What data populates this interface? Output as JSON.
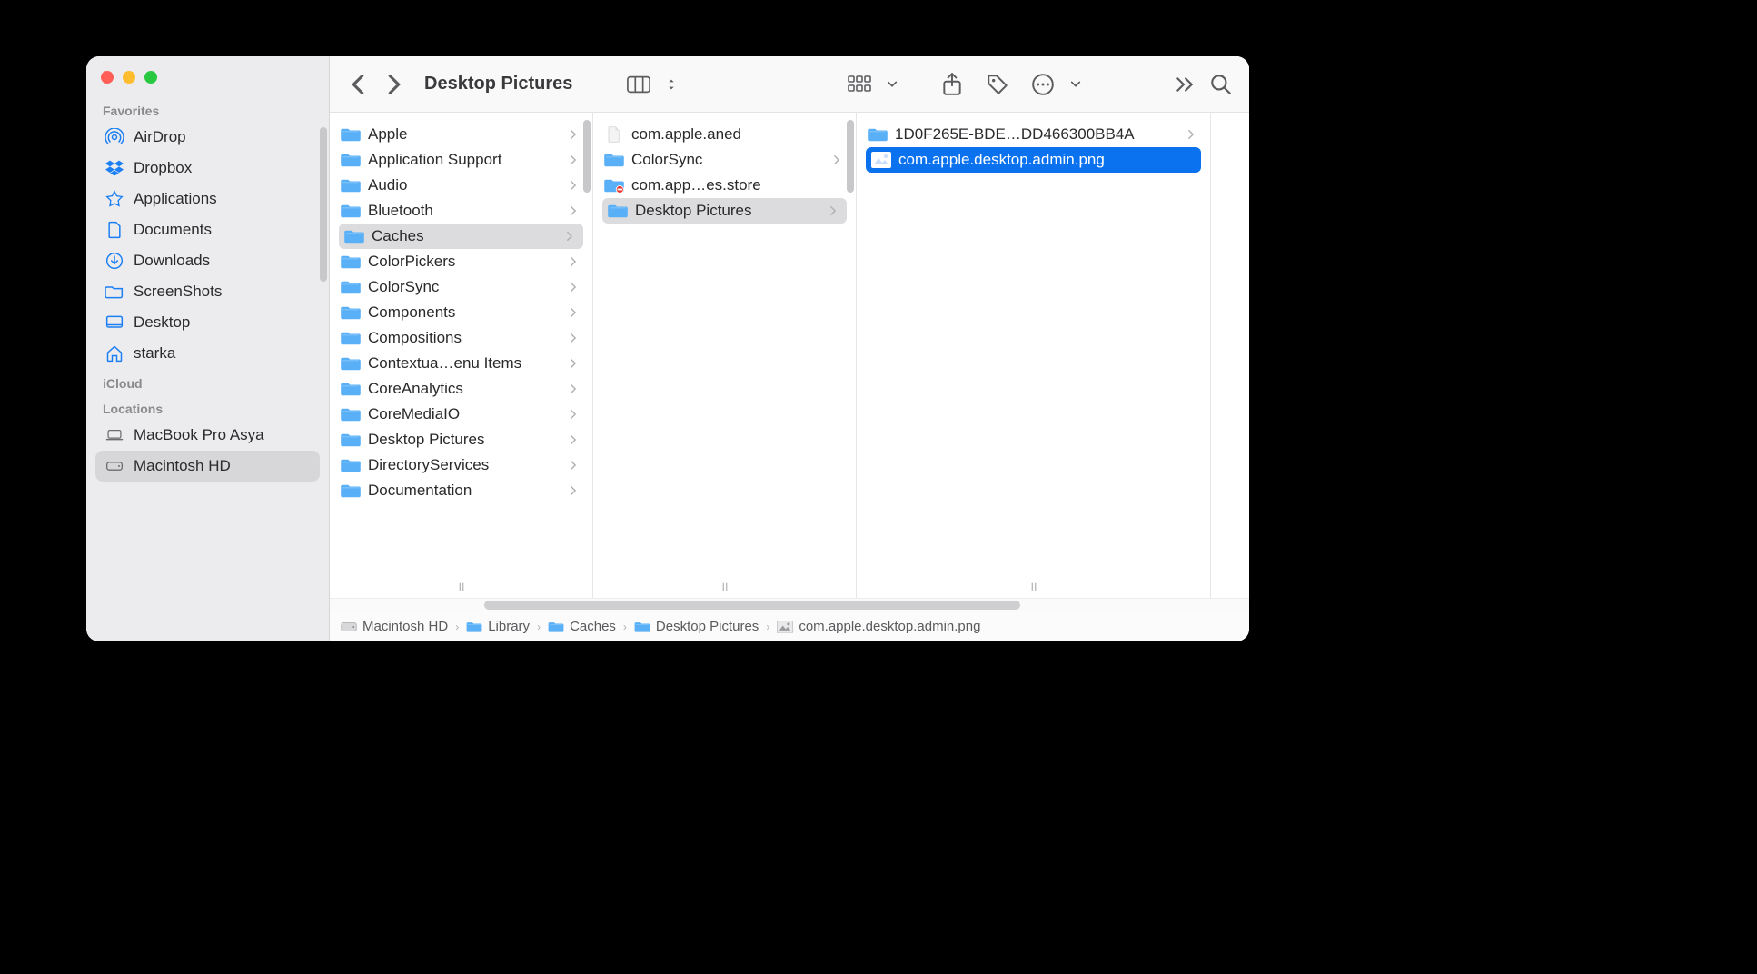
{
  "window_title": "Desktop Pictures",
  "sidebar": {
    "sections": [
      {
        "label": "Favorites",
        "items": [
          {
            "icon": "airdrop",
            "label": "AirDrop"
          },
          {
            "icon": "dropbox",
            "label": "Dropbox"
          },
          {
            "icon": "applications",
            "label": "Applications"
          },
          {
            "icon": "documents",
            "label": "Documents"
          },
          {
            "icon": "downloads",
            "label": "Downloads"
          },
          {
            "icon": "folder",
            "label": "ScreenShots"
          },
          {
            "icon": "desktop",
            "label": "Desktop"
          },
          {
            "icon": "home",
            "label": "starka"
          }
        ]
      },
      {
        "label": "iCloud",
        "items": []
      },
      {
        "label": "Locations",
        "items": [
          {
            "icon": "laptop",
            "label": "MacBook Pro Asya",
            "gray": true
          },
          {
            "icon": "disk",
            "label": "Macintosh HD",
            "gray": true,
            "selected": true
          }
        ]
      }
    ]
  },
  "columns": [
    {
      "width": "normal",
      "scroll": true,
      "items": [
        {
          "type": "folder",
          "label": "Apple",
          "arrow": true
        },
        {
          "type": "folder",
          "label": "Application Support",
          "arrow": true
        },
        {
          "type": "folder",
          "label": "Audio",
          "arrow": true
        },
        {
          "type": "folder",
          "label": "Bluetooth",
          "arrow": true
        },
        {
          "type": "folder",
          "label": "Caches",
          "arrow": true,
          "selected": "gray"
        },
        {
          "type": "folder",
          "label": "ColorPickers",
          "arrow": true
        },
        {
          "type": "folder",
          "label": "ColorSync",
          "arrow": true
        },
        {
          "type": "folder",
          "label": "Components",
          "arrow": true
        },
        {
          "type": "folder",
          "label": "Compositions",
          "arrow": true
        },
        {
          "type": "folder",
          "label": "Contextua…enu Items",
          "arrow": true
        },
        {
          "type": "folder",
          "label": "CoreAnalytics",
          "arrow": true
        },
        {
          "type": "folder",
          "label": "CoreMediaIO",
          "arrow": true
        },
        {
          "type": "folder",
          "label": "Desktop Pictures",
          "arrow": true
        },
        {
          "type": "folder",
          "label": "DirectoryServices",
          "arrow": true
        },
        {
          "type": "folder",
          "label": "Documentation",
          "arrow": true
        }
      ]
    },
    {
      "width": "normal",
      "scroll": true,
      "items": [
        {
          "type": "file",
          "label": "com.apple.aned"
        },
        {
          "type": "folder",
          "label": "ColorSync",
          "arrow": true
        },
        {
          "type": "folder-blocked",
          "label": "com.app…es.store"
        },
        {
          "type": "folder",
          "label": "Desktop Pictures",
          "arrow": true,
          "selected": "gray"
        }
      ]
    },
    {
      "width": "wide",
      "items": [
        {
          "type": "folder",
          "label": "1D0F265E-BDE…DD466300BB4A",
          "arrow": true
        },
        {
          "type": "image",
          "label": "com.apple.desktop.admin.png",
          "selected": "blue"
        }
      ]
    }
  ],
  "pathbar": [
    {
      "icon": "disk",
      "label": "Macintosh HD"
    },
    {
      "icon": "folder",
      "label": "Library"
    },
    {
      "icon": "folder",
      "label": "Caches"
    },
    {
      "icon": "folder",
      "label": "Desktop Pictures"
    },
    {
      "icon": "image",
      "label": "com.apple.desktop.admin.png"
    }
  ]
}
